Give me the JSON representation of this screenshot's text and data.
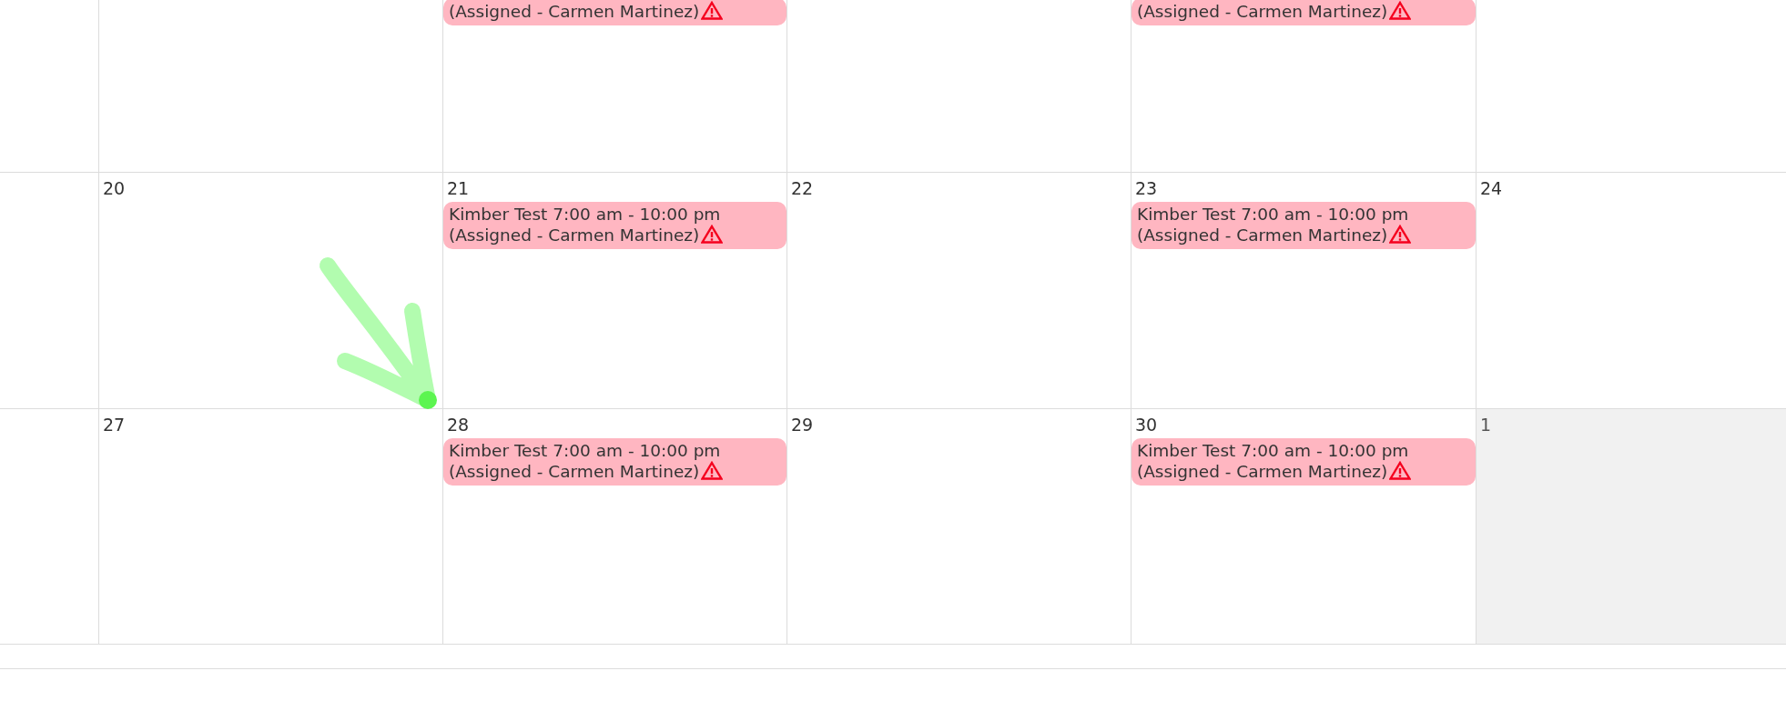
{
  "weeks": [
    {
      "days": [
        {
          "other_month": false
        },
        {
          "other_month": false
        },
        {
          "other_month": false,
          "events": [
            {
              "detail": "(Assigned - Carmen Martinez)",
              "warning": true
            }
          ]
        },
        {
          "other_month": false
        },
        {
          "other_month": false,
          "events": [
            {
              "detail": "(Assigned - Carmen Martinez)",
              "warning": true
            }
          ]
        },
        {
          "other_month": false
        }
      ]
    },
    {
      "days": [
        {
          "other_month": false
        },
        {
          "day": "20",
          "other_month": false
        },
        {
          "day": "21",
          "other_month": false,
          "events": [
            {
              "title": "Kimber Test 7:00 am - 10:00 pm",
              "detail": "(Assigned - Carmen Martinez)",
              "warning": true
            }
          ]
        },
        {
          "day": "22",
          "other_month": false
        },
        {
          "day": "23",
          "other_month": false,
          "events": [
            {
              "title": "Kimber Test 7:00 am - 10:00 pm",
              "detail": "(Assigned - Carmen Martinez)",
              "warning": true
            }
          ]
        },
        {
          "day": "24",
          "other_month": false
        }
      ]
    },
    {
      "days": [
        {
          "other_month": false
        },
        {
          "day": "27",
          "other_month": false
        },
        {
          "day": "28",
          "other_month": false,
          "events": [
            {
              "title": "Kimber Test 7:00 am - 10:00 pm",
              "detail": "(Assigned - Carmen Martinez)",
              "warning": true
            }
          ]
        },
        {
          "day": "29",
          "other_month": false
        },
        {
          "day": "30",
          "other_month": false,
          "events": [
            {
              "title": "Kimber Test 7:00 am - 10:00 pm",
              "detail": "(Assigned - Carmen Martinez)",
              "warning": true
            }
          ]
        },
        {
          "day": "1",
          "other_month": true
        }
      ]
    }
  ]
}
